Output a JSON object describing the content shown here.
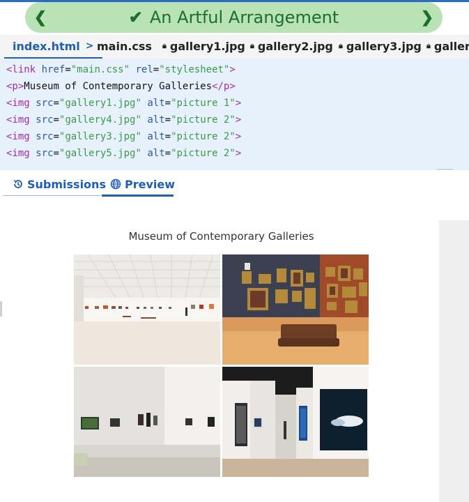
{
  "header": {
    "title": "An Artful Arrangement",
    "prev_icon": "chevron-left-icon",
    "next_icon": "chevron-right-icon",
    "status_icon": "check-icon",
    "accent": "#1b6e2c",
    "pill_color": "#b9e3b5"
  },
  "file_tabs": [
    {
      "label": "index.html",
      "active": true,
      "locked": false
    },
    {
      "label": "main.css",
      "active": false,
      "locked": false
    },
    {
      "label": "gallery1.jpg",
      "active": false,
      "locked": true
    },
    {
      "label": "gallery2.jpg",
      "active": false,
      "locked": true
    },
    {
      "label": "gallery3.jpg",
      "active": false,
      "locked": true
    },
    {
      "label": "gallery",
      "active": false,
      "locked": true
    }
  ],
  "code_lines": [
    "<link href=\"main.css\" rel=\"stylesheet\">",
    "<p>Museum of Contemporary Galleries</p>",
    "<img src=\"gallery1.jpg\" alt=\"picture 1\">",
    "<img src=\"gallery4.jpg\" alt=\"picture 2\">",
    "<img src=\"gallery3.jpg\" alt=\"picture 2\">",
    "<img src=\"gallery5.jpg\" alt=\"picture 2\">"
  ],
  "panel_tabs": {
    "submissions": "Submissions",
    "preview": "Preview",
    "active": "preview"
  },
  "preview": {
    "heading": "Museum of Contemporary Galleries",
    "images": [
      {
        "alt": "picture 1",
        "scene": "white-hall-gallery"
      },
      {
        "alt": "picture 2",
        "scene": "classic-paintings-room"
      },
      {
        "alt": "picture 2",
        "scene": "modern-white-gallery"
      },
      {
        "alt": "picture 2",
        "scene": "gallery-wall-panels"
      }
    ]
  }
}
